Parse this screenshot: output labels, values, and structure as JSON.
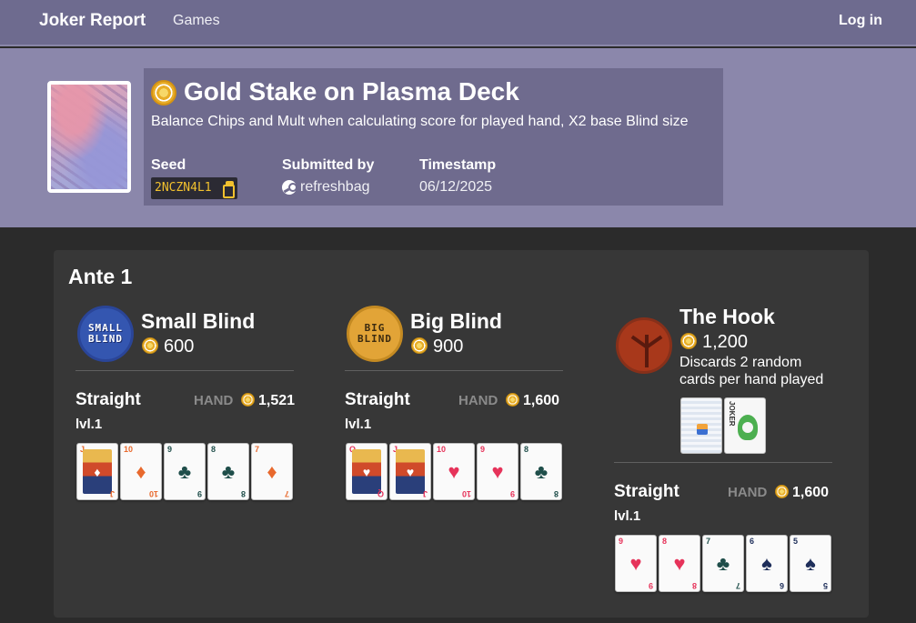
{
  "nav": {
    "brand": "Joker Report",
    "games": "Games",
    "login": "Log in"
  },
  "header": {
    "title": "Gold Stake on Plasma Deck",
    "subtitle": "Balance Chips and Mult when calculating score for played hand, X2 base Blind size",
    "seed_label": "Seed",
    "seed_value": "2NCZN4L1",
    "submitted_label": "Submitted by",
    "submitted_value": "refreshbag",
    "timestamp_label": "Timestamp",
    "timestamp_value": "06/12/2025"
  },
  "ante": {
    "title": "Ante 1",
    "blinds": [
      {
        "icon_text_1": "SMALL",
        "icon_text_2": "BLIND",
        "name": "Small Blind",
        "score": "600",
        "hand": "Straight",
        "hand_tag": "HAND",
        "hand_score": "1,521",
        "level": "lvl.1",
        "cards": [
          {
            "rank": "J",
            "suit": "♦",
            "class": "s-dia",
            "face": true
          },
          {
            "rank": "10",
            "suit": "♦",
            "class": "s-dia",
            "face": false
          },
          {
            "rank": "9",
            "suit": "♣",
            "class": "s-club",
            "face": false
          },
          {
            "rank": "8",
            "suit": "♣",
            "class": "s-club",
            "face": false
          },
          {
            "rank": "7",
            "suit": "♦",
            "class": "s-dia",
            "face": false
          }
        ]
      },
      {
        "icon_text_1": "BIG",
        "icon_text_2": "BLIND",
        "name": "Big Blind",
        "score": "900",
        "hand": "Straight",
        "hand_tag": "HAND",
        "hand_score": "1,600",
        "level": "lvl.1",
        "cards": [
          {
            "rank": "Q",
            "suit": "♥",
            "class": "s-heart",
            "face": true
          },
          {
            "rank": "J",
            "suit": "♥",
            "class": "s-heart",
            "face": true
          },
          {
            "rank": "10",
            "suit": "♥",
            "class": "s-heart",
            "face": false
          },
          {
            "rank": "9",
            "suit": "♥",
            "class": "s-heart",
            "face": false
          },
          {
            "rank": "8",
            "suit": "♣",
            "class": "s-club",
            "face": false
          }
        ]
      },
      {
        "name": "The Hook",
        "score": "1,200",
        "description": "Discards 2 random cards per hand played",
        "hand": "Straight",
        "hand_tag": "HAND",
        "hand_score": "1,600",
        "level": "lvl.1",
        "jokers": [
          {
            "label": "",
            "kind": "back"
          },
          {
            "label": "JOKER",
            "kind": "joker"
          }
        ],
        "cards": [
          {
            "rank": "9",
            "suit": "♥",
            "class": "s-heart",
            "face": false
          },
          {
            "rank": "8",
            "suit": "♥",
            "class": "s-heart",
            "face": false
          },
          {
            "rank": "7",
            "suit": "♣",
            "class": "s-club",
            "face": false
          },
          {
            "rank": "6",
            "suit": "♠",
            "class": "s-spade",
            "face": false
          },
          {
            "rank": "5",
            "suit": "♠",
            "class": "s-spade",
            "face": false
          }
        ]
      }
    ]
  }
}
